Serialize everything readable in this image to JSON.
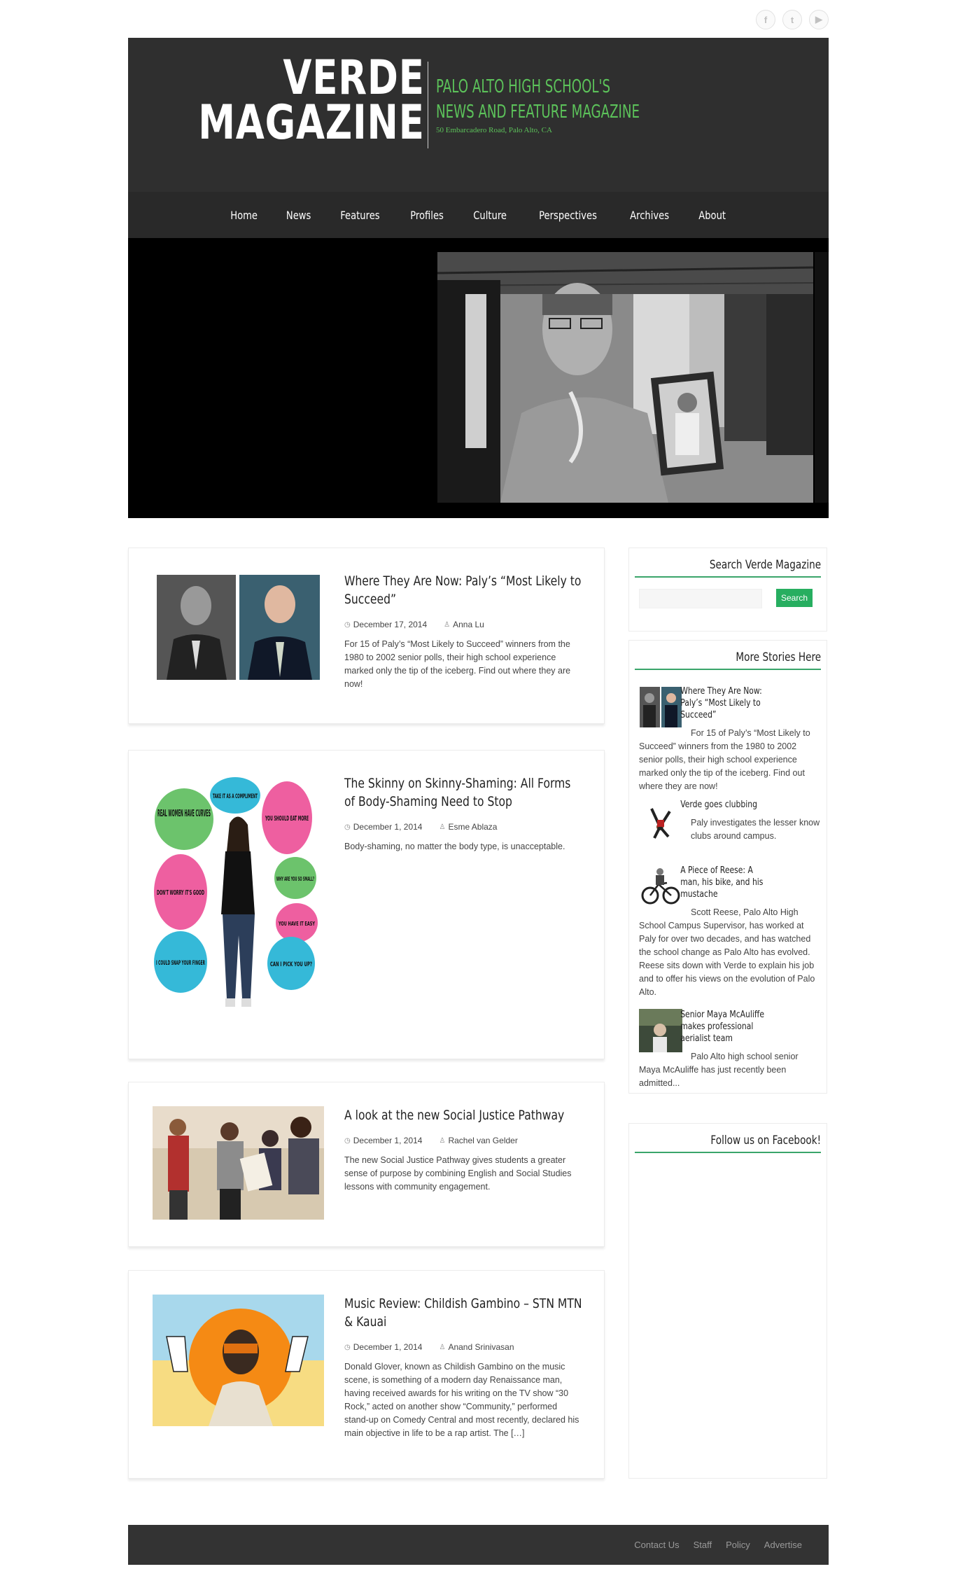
{
  "social": {
    "facebook_glyph": "f",
    "twitter_glyph": "t",
    "youtube_glyph": "▶"
  },
  "header": {
    "logo_line1": "VERDE",
    "logo_line2": "MAGAZINE",
    "tagline_line1": "PALO ALTO HIGH SCHOOL'S",
    "tagline_line2": "NEWS AND FEATURE MAGAZINE",
    "address": "50 Embarcadero Road, Palo Alto, CA",
    "tagline_color": "#5cc25a"
  },
  "nav": {
    "items": [
      "Home",
      "News",
      "Features",
      "Profiles",
      "Culture",
      "Perspectives",
      "Archives",
      "About"
    ]
  },
  "articles": [
    {
      "title": "Where They Are Now: Paly’s “Most Likely to Succeed”",
      "date": "December 17, 2014",
      "author": "Anna Lu",
      "excerpt": "For 15 of Paly’s “Most Likely to Succeed” winners from the 1980 to 2002 senior polls, their high school experience marked only the tip of the iceberg. Find out where they are now!"
    },
    {
      "title": "The Skinny on Skinny-Shaming: All Forms of Body-Shaming Need to Stop",
      "date": "December 1, 2014",
      "author": "Esme Ablaza",
      "excerpt": "Body-shaming, no matter the body type, is unacceptable.",
      "bubbles": [
        "REAL WOMEN HAVE CURVES",
        "TAKE IT AS A COMPLIMENT",
        "YOU SHOULD EAT MORE",
        "DON'T WORRY IT'S GOOD",
        "WHY ARE YOU SO SMALL?",
        "YOU HAVE IT EASY",
        "I COULD SNAP YOUR FINGER",
        "CAN I PICK YOU UP?"
      ]
    },
    {
      "title": "A look at the new Social Justice Pathway",
      "date": "December 1, 2014",
      "author": "Rachel van Gelder",
      "excerpt": "The new Social Justice Pathway gives students a greater sense of purpose by combining English and Social Studies lessons with community engagement."
    },
    {
      "title": "Music Review: Childish Gambino – STN MTN & Kauai",
      "date": "December 1, 2014",
      "author": "Anand Srinivasan",
      "excerpt": "Donald Glover, known as Childish Gambino on the music scene, is something of a modern day Renaissance man, having received awards for his writing on the TV show “30 Rock,” acted on another show “Community,” performed stand-up on Comedy Central and most recently, declared his main objective in life to be a rap artist. The […]"
    }
  ],
  "sidebar": {
    "search": {
      "title": "Search Verde Magazine",
      "placeholder": "",
      "button": "Search"
    },
    "more": {
      "title": "More Stories Here",
      "stories": [
        {
          "title": "Where They Are Now: Paly’s “Most Likely to Succeed”",
          "excerpt": "For 15 of Paly’s “Most Likely to Succeed” winners from the 1980 to 2002 senior polls, their high school experience marked only the tip of the iceberg. Find out where they are now!"
        },
        {
          "title": "Verde goes clubbing",
          "excerpt": "Paly investigates the lesser know clubs around campus."
        },
        {
          "title": "A Piece of Reese: A man, his bike, and his mustache",
          "excerpt": "Scott Reese, Palo Alto High School Campus Supervisor, has worked at Paly for over two decades, and has watched the school change as Palo Alto has evolved. Reese sits down with Verde to explain his job and to offer his views on the evolution of Palo Alto."
        },
        {
          "title": "Senior Maya McAuliffe makes professional aerialist team",
          "excerpt": "Palo Alto high school senior Maya McAuliffe has just recently been admitted..."
        }
      ]
    },
    "facebook": {
      "title": "Follow us on Facebook!"
    }
  },
  "footer": {
    "links": [
      "Contact Us",
      "Staff",
      "Policy",
      "Advertise"
    ]
  },
  "colors": {
    "accent": "#27ae60",
    "header_bg": "#2f2f2f",
    "nav_bg": "#292929",
    "footer_bg": "#333333"
  }
}
